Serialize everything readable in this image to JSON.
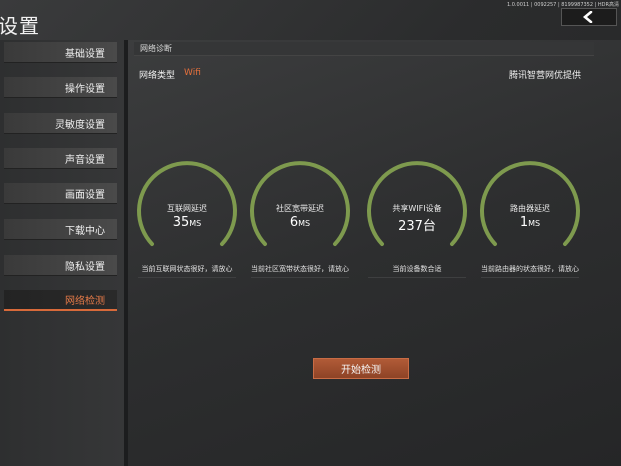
{
  "header": {
    "title": "设置",
    "version": "1.0.0011 | 0092257 | 8199987352 | HDR高清",
    "back_icon": "chevron-left-icon"
  },
  "sidebar": {
    "items": [
      {
        "label": "基础设置",
        "active": false
      },
      {
        "label": "操作设置",
        "active": false
      },
      {
        "label": "灵敏度设置",
        "active": false
      },
      {
        "label": "声音设置",
        "active": false
      },
      {
        "label": "画面设置",
        "active": false
      },
      {
        "label": "下载中心",
        "active": false
      },
      {
        "label": "隐私设置",
        "active": false
      },
      {
        "label": "网络检测",
        "active": true
      }
    ]
  },
  "main": {
    "section_title": "网络诊断",
    "network_type_label": "网络类型",
    "network_type_value": "Wifi",
    "provider": "腾讯智营网优提供",
    "gauges": [
      {
        "label": "互联网延迟",
        "value": "35",
        "unit": "MS",
        "note": "当前互联网状态很好，请放心"
      },
      {
        "label": "社区宽带延迟",
        "value": "6",
        "unit": "MS",
        "note": "当前社区宽带状态很好，请放心"
      },
      {
        "label": "共享WIFI设备",
        "value": "237台",
        "unit": "",
        "note": "当前设备数合适"
      },
      {
        "label": "路由器延迟",
        "value": "1",
        "unit": "MS",
        "note": "当前路由器的状态很好，请放心"
      }
    ],
    "start_button": "开始检测"
  },
  "colors": {
    "accent": "#e6703c",
    "gauge": "#7e9a4e",
    "button": "#a4502f"
  }
}
